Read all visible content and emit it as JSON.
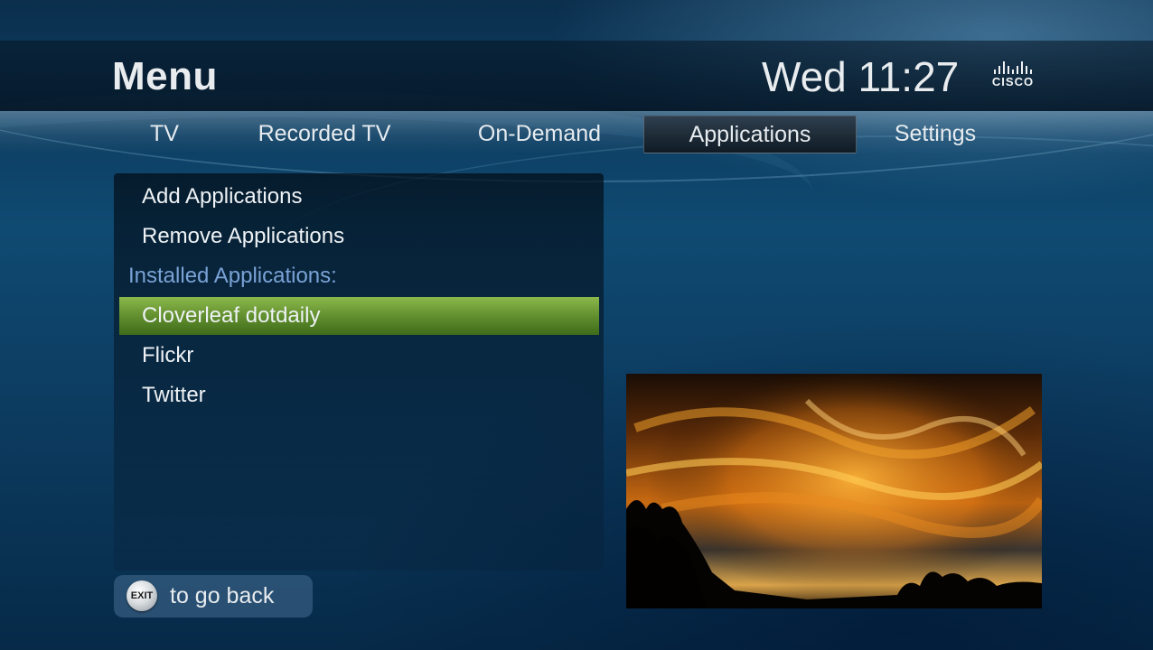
{
  "header": {
    "title": "Menu",
    "clock": "Wed 11:27",
    "logo_text": "CISCO"
  },
  "nav": {
    "tabs": [
      {
        "label": "TV",
        "selected": false
      },
      {
        "label": "Recorded TV",
        "selected": false
      },
      {
        "label": "On-Demand",
        "selected": false
      },
      {
        "label": "Applications",
        "selected": true
      },
      {
        "label": "Settings",
        "selected": false
      }
    ]
  },
  "menu": {
    "actions": [
      {
        "label": "Add Applications"
      },
      {
        "label": "Remove Applications"
      }
    ],
    "section_label": "Installed Applications:",
    "applications": [
      {
        "label": "Cloverleaf dotdaily",
        "selected": true
      },
      {
        "label": "Flickr",
        "selected": false
      },
      {
        "label": "Twitter",
        "selected": false
      }
    ]
  },
  "preview": {
    "icon": "sunset-photo"
  },
  "footer": {
    "exit_key": "EXIT",
    "hint": "to go back"
  },
  "colors": {
    "selection_green": "#6a9a34",
    "section_label_blue": "#7aa2d6",
    "text_white": "#e8ecef"
  }
}
